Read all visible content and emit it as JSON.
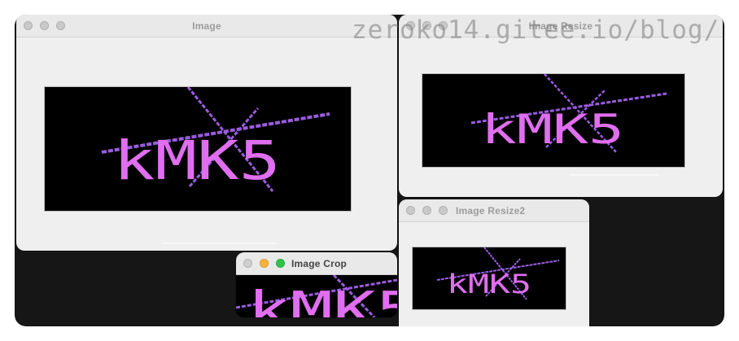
{
  "windows": {
    "image": {
      "title": "Image"
    },
    "resize": {
      "title": "Image Resize"
    },
    "resize2": {
      "title": "Image Resize2"
    },
    "crop": {
      "title": "Image Crop"
    }
  },
  "captcha": {
    "text": "kMK5",
    "glyph_color": "#e06ef0",
    "line_color": "#9a5ce0",
    "background": "#000000"
  },
  "traffic_lights": {
    "inactive": "#c9c9c9",
    "minimize": "#f5b33a",
    "zoom": "#30c44a"
  },
  "watermark": "zeroko14.gitee.io/blog/"
}
